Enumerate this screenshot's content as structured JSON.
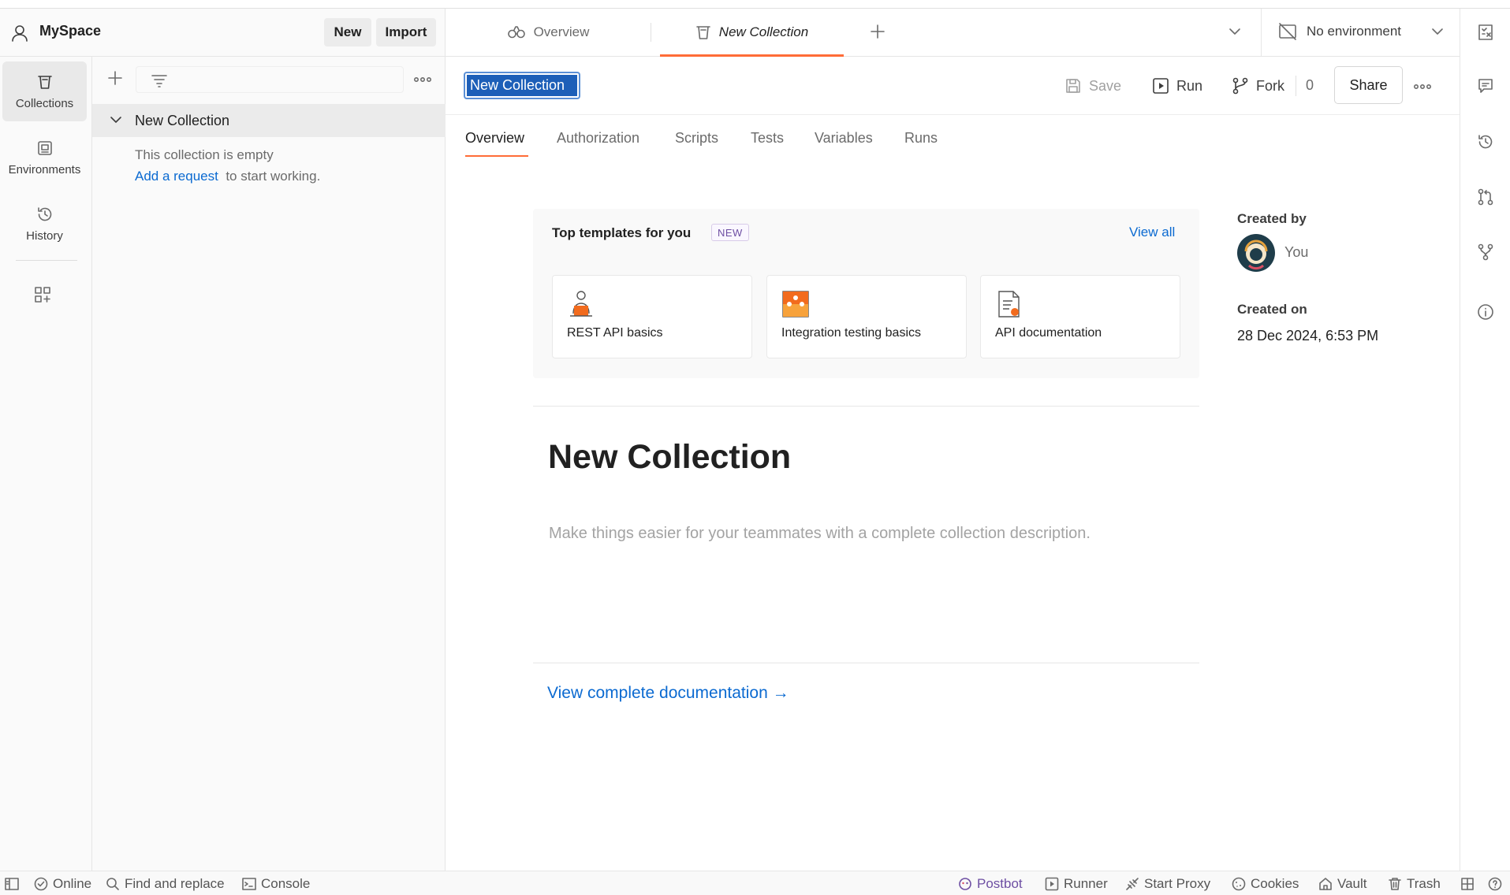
{
  "workspace": {
    "name": "MySpace",
    "new_label": "New",
    "import_label": "Import"
  },
  "nav_rail": {
    "items": [
      {
        "label": "Collections",
        "icon": "collections-icon",
        "active": true
      },
      {
        "label": "Environments",
        "icon": "environments-icon",
        "active": false
      },
      {
        "label": "History",
        "icon": "history-icon",
        "active": false
      }
    ],
    "configure_icon": "configure-workbench-icon"
  },
  "sidebar": {
    "collection_name": "New Collection",
    "empty_text": "This collection is empty",
    "add_request_link": "Add a request",
    "add_request_suffix": "to start working."
  },
  "tabs": {
    "items": [
      {
        "label": "Overview",
        "icon": "overview-icon",
        "active": false
      },
      {
        "label": "New Collection",
        "icon": "collection-icon",
        "active": true
      }
    ]
  },
  "environment": {
    "label": "No environment"
  },
  "collection_header": {
    "title_value": "New Collection",
    "save_label": "Save",
    "run_label": "Run",
    "fork_label": "Fork",
    "fork_count": "0",
    "share_label": "Share"
  },
  "sub_tabs": {
    "overview": "Overview",
    "authorization": "Authorization",
    "scripts": "Scripts",
    "tests": "Tests",
    "variables": "Variables",
    "runs": "Runs"
  },
  "templates": {
    "title": "Top templates for you",
    "badge": "NEW",
    "view_all": "View all",
    "cards": [
      {
        "label": "REST API basics",
        "icon": "rest-api-icon"
      },
      {
        "label": "Integration testing basics",
        "icon": "puzzle-icon"
      },
      {
        "label": "API documentation",
        "icon": "documentation-icon"
      }
    ]
  },
  "overview": {
    "heading": "New Collection",
    "description_placeholder": "Make things easier for your teammates with a complete collection description.",
    "view_docs": "View complete documentation →"
  },
  "meta": {
    "created_by_label": "Created by",
    "created_by_value": "You",
    "created_on_label": "Created on",
    "created_on_value": "28 Dec 2024, 6:53 PM"
  },
  "status_bar": {
    "online": "Online",
    "find_replace": "Find and replace",
    "console": "Console",
    "postbot": "Postbot",
    "runner": "Runner",
    "start_proxy": "Start Proxy",
    "cookies": "Cookies",
    "vault": "Vault",
    "trash": "Trash"
  },
  "colors": {
    "accent": "#ff6c37",
    "link": "#0b6ad1",
    "selection": "#1d5fb8",
    "postbot": "#6e4fa3"
  }
}
